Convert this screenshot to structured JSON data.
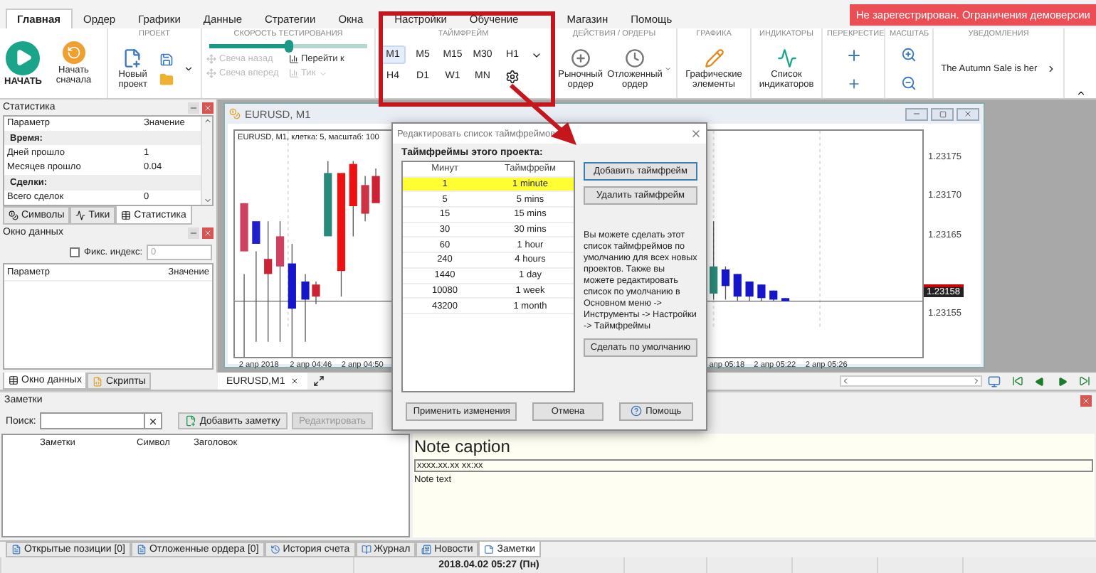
{
  "menu_tabs": [
    {
      "label": "Главная",
      "selected": true
    },
    {
      "label": "Ордер",
      "selected": false
    },
    {
      "label": "Графики",
      "selected": false
    },
    {
      "label": "Данные",
      "selected": false
    },
    {
      "label": "Стратегии",
      "selected": false
    },
    {
      "label": "Окна",
      "selected": false
    },
    {
      "label": "Настройки",
      "selected": false
    },
    {
      "label": "Обучение",
      "selected": false
    },
    {
      "label": "Магазин",
      "selected": false
    },
    {
      "label": "Помощь",
      "selected": false
    }
  ],
  "registration_banner": "Не зарегестрирован. Ограничения демоверсии",
  "ribbon": {
    "start": {
      "start_label": "НАЧАТЬ",
      "restart_label": "Начать сначала"
    },
    "project": {
      "title": "ПРОЕКТ",
      "new_label": "Новый проект"
    },
    "speed": {
      "title": "СКОРОСТЬ ТЕСТИРОВАНИЯ",
      "level": 0.5,
      "buttons": [
        {
          "label": "Свеча назад",
          "disabled": true
        },
        {
          "label": "Перейти к",
          "disabled": false
        },
        {
          "label": "Свеча вперед",
          "disabled": true
        },
        {
          "label": "Тик",
          "disabled": true
        }
      ]
    },
    "timeframes": {
      "title": "ТАЙМФРЕЙМ",
      "items": [
        {
          "label": "M1",
          "selected": true
        },
        {
          "label": "M5",
          "selected": false
        },
        {
          "label": "M15",
          "selected": false
        },
        {
          "label": "M30",
          "selected": false
        },
        {
          "label": "H1",
          "selected": false
        },
        {
          "label": "H4",
          "selected": false
        },
        {
          "label": "D1",
          "selected": false
        },
        {
          "label": "W1",
          "selected": false
        },
        {
          "label": "MN",
          "selected": false
        }
      ]
    },
    "actions": {
      "title": "ДЕЙСТВИЯ / ОРДЕРЫ",
      "buttons": [
        "Рыночный ордер",
        "Отложенный ордер"
      ]
    },
    "graphics": {
      "title": "ГРАФИКА",
      "button": "Графические элементы"
    },
    "indicators": {
      "title": "ИНДИКАТОРЫ",
      "button": "Список индикаторов"
    },
    "crosshair": {
      "title": "ПЕРЕКРЕСТИЕ"
    },
    "zoom": {
      "title": "МАСШТАБ"
    },
    "notifications": {
      "title": "УВЕДОМЛЕНИЯ",
      "text": "The Autumn Sale is her"
    }
  },
  "statistics_panel": {
    "title": "Статистика",
    "columns": [
      "Параметр",
      "Значение"
    ],
    "rows": [
      {
        "kind": "section",
        "name": "Время:"
      },
      {
        "kind": "row",
        "name": "Дней прошло",
        "value": "1"
      },
      {
        "kind": "row",
        "name": "Месяцев прошло",
        "value": "0.04"
      },
      {
        "kind": "section",
        "name": "Сделки:"
      },
      {
        "kind": "row",
        "name": "Всего сделок",
        "value": "0"
      }
    ]
  },
  "left_tabs": [
    {
      "label": "Символы",
      "selected": false
    },
    {
      "label": "Тики",
      "selected": false
    },
    {
      "label": "Статистика",
      "selected": true
    }
  ],
  "data_window": {
    "title": "Окно данных",
    "fix_index_label": "Фикс. индекс:",
    "fix_index_checked": false,
    "fix_index_value": "0",
    "columns": [
      "Параметр",
      "Значение"
    ]
  },
  "left_bottom_tabs": [
    {
      "label": "Окно данных",
      "selected": true
    },
    {
      "label": "Скрипты",
      "selected": false
    }
  ],
  "chart_window": {
    "title": "EURUSD, M1",
    "info": "EURUSD, M1, клетка: 5, масштаб: 100",
    "price_labels": [
      "1.23175",
      "1.23170",
      "1.23165",
      "1.23155"
    ],
    "current_price": "1.23158",
    "time_labels": [
      "2 апр 2018",
      "2 апр 04:46",
      "2 апр 04:50",
      "апр 05:18",
      "2 апр 05:22",
      "2 апр 05:26"
    ]
  },
  "chart_tabs": [
    {
      "label": "EURUSD,M1",
      "selected": true
    }
  ],
  "dialog": {
    "title": "Редактировать список таймфреймов",
    "list_title": "Таймфреймы этого проекта:",
    "columns": [
      "Минут",
      "Таймфрейм"
    ],
    "rows": [
      {
        "minutes": "1",
        "name": "1 minute",
        "selected": true
      },
      {
        "minutes": "5",
        "name": "5 mins",
        "selected": false
      },
      {
        "minutes": "15",
        "name": "15 mins",
        "selected": false
      },
      {
        "minutes": "30",
        "name": "30 mins",
        "selected": false
      },
      {
        "minutes": "60",
        "name": "1 hour",
        "selected": false
      },
      {
        "minutes": "240",
        "name": "4 hours",
        "selected": false
      },
      {
        "minutes": "1440",
        "name": "1 day",
        "selected": false
      },
      {
        "minutes": "10080",
        "name": "1 week",
        "selected": false
      },
      {
        "minutes": "43200",
        "name": "1 month",
        "selected": false
      }
    ],
    "add_button": "Добавить таймфрейм",
    "remove_button": "Удалить таймфрейм",
    "info": "Вы можете сделать этот список таймфреймов по умолчанию для всех новых проектов. Также вы можете редактировать список по умолчанию в Основном меню -> Инструменты -> Настройки -> Таймфреймы",
    "default_button": "Сделать по умолчанию",
    "apply_button": "Применить изменения",
    "cancel_button": "Отмена",
    "help_button": "Помощь"
  },
  "notes_panel": {
    "title": "Заметки",
    "search_label": "Поиск:",
    "add_button": "Добавить заметку",
    "edit_button": "Редактировать",
    "columns": [
      "Заметки",
      "Символ",
      "Заголовок"
    ],
    "caption": "Note caption",
    "date": "xxxx.xx.xx xx:xx",
    "text": "Note text"
  },
  "bottom_tabs": [
    {
      "label": "Открытые позиции [0]",
      "selected": false
    },
    {
      "label": "Отложенные ордера [0]",
      "selected": false
    },
    {
      "label": "История счета",
      "selected": false
    },
    {
      "label": "Журнал",
      "selected": false
    },
    {
      "label": "Новости",
      "selected": false
    },
    {
      "label": "Заметки",
      "selected": true
    }
  ],
  "status_bar": {
    "datetime": "2018.04.02 05:27 (Пн)"
  }
}
